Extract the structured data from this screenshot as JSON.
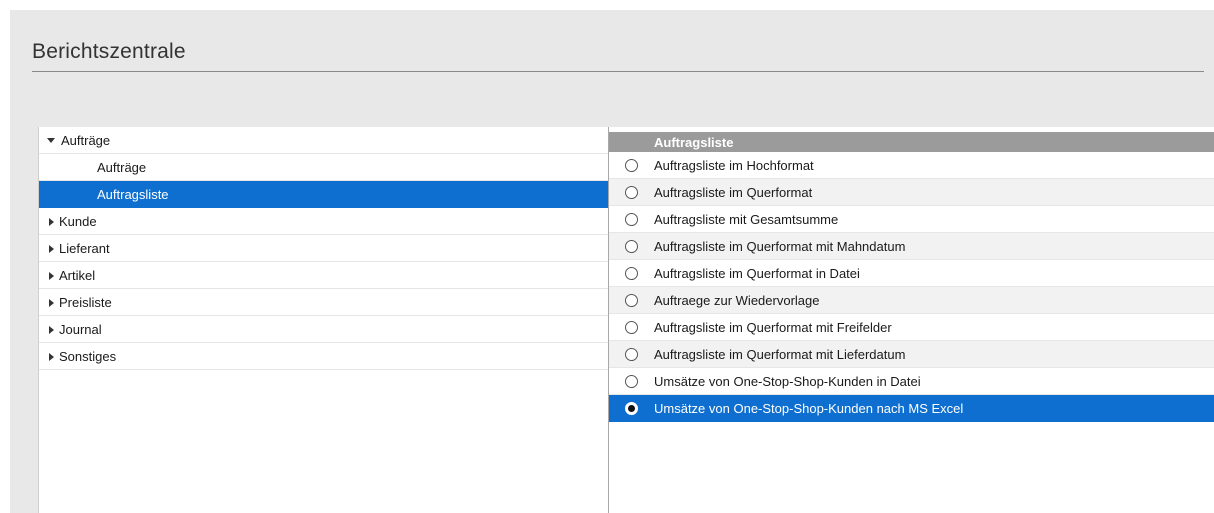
{
  "app": {
    "title": "Berichtszentrale"
  },
  "tree": {
    "items": [
      {
        "label": "Aufträge",
        "expanded": true,
        "level": 0
      },
      {
        "label": "Aufträge",
        "level": 1
      },
      {
        "label": "Auftragsliste",
        "level": 1,
        "selected": true
      },
      {
        "label": "Kunde",
        "expanded": false,
        "level": 0
      },
      {
        "label": "Lieferant",
        "expanded": false,
        "level": 0
      },
      {
        "label": "Artikel",
        "expanded": false,
        "level": 0
      },
      {
        "label": "Preisliste",
        "expanded": false,
        "level": 0
      },
      {
        "label": "Journal",
        "expanded": false,
        "level": 0
      },
      {
        "label": "Sonstiges",
        "expanded": false,
        "level": 0
      }
    ]
  },
  "report_list": {
    "header": "Auftragsliste",
    "options": [
      {
        "label": "Auftragsliste im Hochformat",
        "selected": false
      },
      {
        "label": "Auftragsliste im Querformat",
        "selected": false
      },
      {
        "label": "Auftragsliste mit Gesamtsumme",
        "selected": false
      },
      {
        "label": "Auftragsliste im Querformat mit Mahndatum",
        "selected": false
      },
      {
        "label": "Auftragsliste im Querformat in Datei",
        "selected": false
      },
      {
        "label": "Auftraege zur Wiedervorlage",
        "selected": false
      },
      {
        "label": "Auftragsliste im Querformat mit Freifelder",
        "selected": false
      },
      {
        "label": "Auftragsliste im Querformat mit Lieferdatum",
        "selected": false
      },
      {
        "label": "Umsätze von One-Stop-Shop-Kunden in Datei",
        "selected": false
      },
      {
        "label": "Umsätze von One-Stop-Shop-Kunden nach MS Excel",
        "selected": true
      }
    ]
  },
  "colors": {
    "selection": "#0f6fd0",
    "header_bg": "#9b9b9b",
    "panel_bg": "#e8e8e8"
  },
  "icons": {
    "expanded": "caret-down-icon",
    "collapsed": "caret-right-icon",
    "radio": "radio-button-icon"
  }
}
